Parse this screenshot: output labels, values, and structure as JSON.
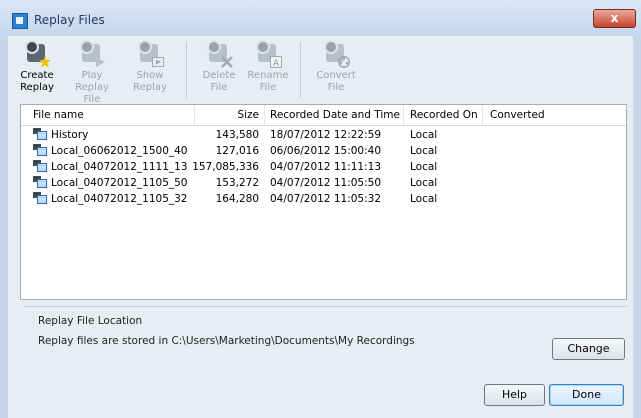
{
  "window": {
    "title": "Replay Files",
    "close_label": "x"
  },
  "toolbar": {
    "create": {
      "line1": "Create",
      "line2": "Replay"
    },
    "play": {
      "line1": "Play Replay",
      "line2": "File"
    },
    "show": {
      "line1": "Show",
      "line2": "Replay"
    },
    "delete": {
      "line1": "Delete",
      "line2": "File"
    },
    "rename": {
      "line1": "Rename",
      "line2": "File"
    },
    "convert": {
      "line1": "Convert",
      "line2": "File"
    }
  },
  "table": {
    "columns": [
      "File name",
      "Size",
      "Recorded Date and Time",
      "Recorded On",
      "Converted"
    ],
    "rows": [
      {
        "name": "History",
        "size": "143,580",
        "datetime": "18/07/2012 12:22:59",
        "on": "Local",
        "converted": ""
      },
      {
        "name": "Local_06062012_1500_40",
        "size": "127,016",
        "datetime": "06/06/2012 15:00:40",
        "on": "Local",
        "converted": ""
      },
      {
        "name": "Local_04072012_1111_13",
        "size": "157,085,336",
        "datetime": "04/07/2012 11:11:13",
        "on": "Local",
        "converted": ""
      },
      {
        "name": "Local_04072012_1105_50",
        "size": "153,272",
        "datetime": "04/07/2012 11:05:50",
        "on": "Local",
        "converted": ""
      },
      {
        "name": "Local_04072012_1105_32",
        "size": "164,280",
        "datetime": "04/07/2012 11:05:32",
        "on": "Local",
        "converted": ""
      }
    ]
  },
  "location": {
    "heading": "Replay File Location",
    "text": "Replay files are stored in C:\\Users\\Marketing\\Documents\\My Recordings"
  },
  "buttons": {
    "change": "Change",
    "help": "Help",
    "done": "Done"
  }
}
